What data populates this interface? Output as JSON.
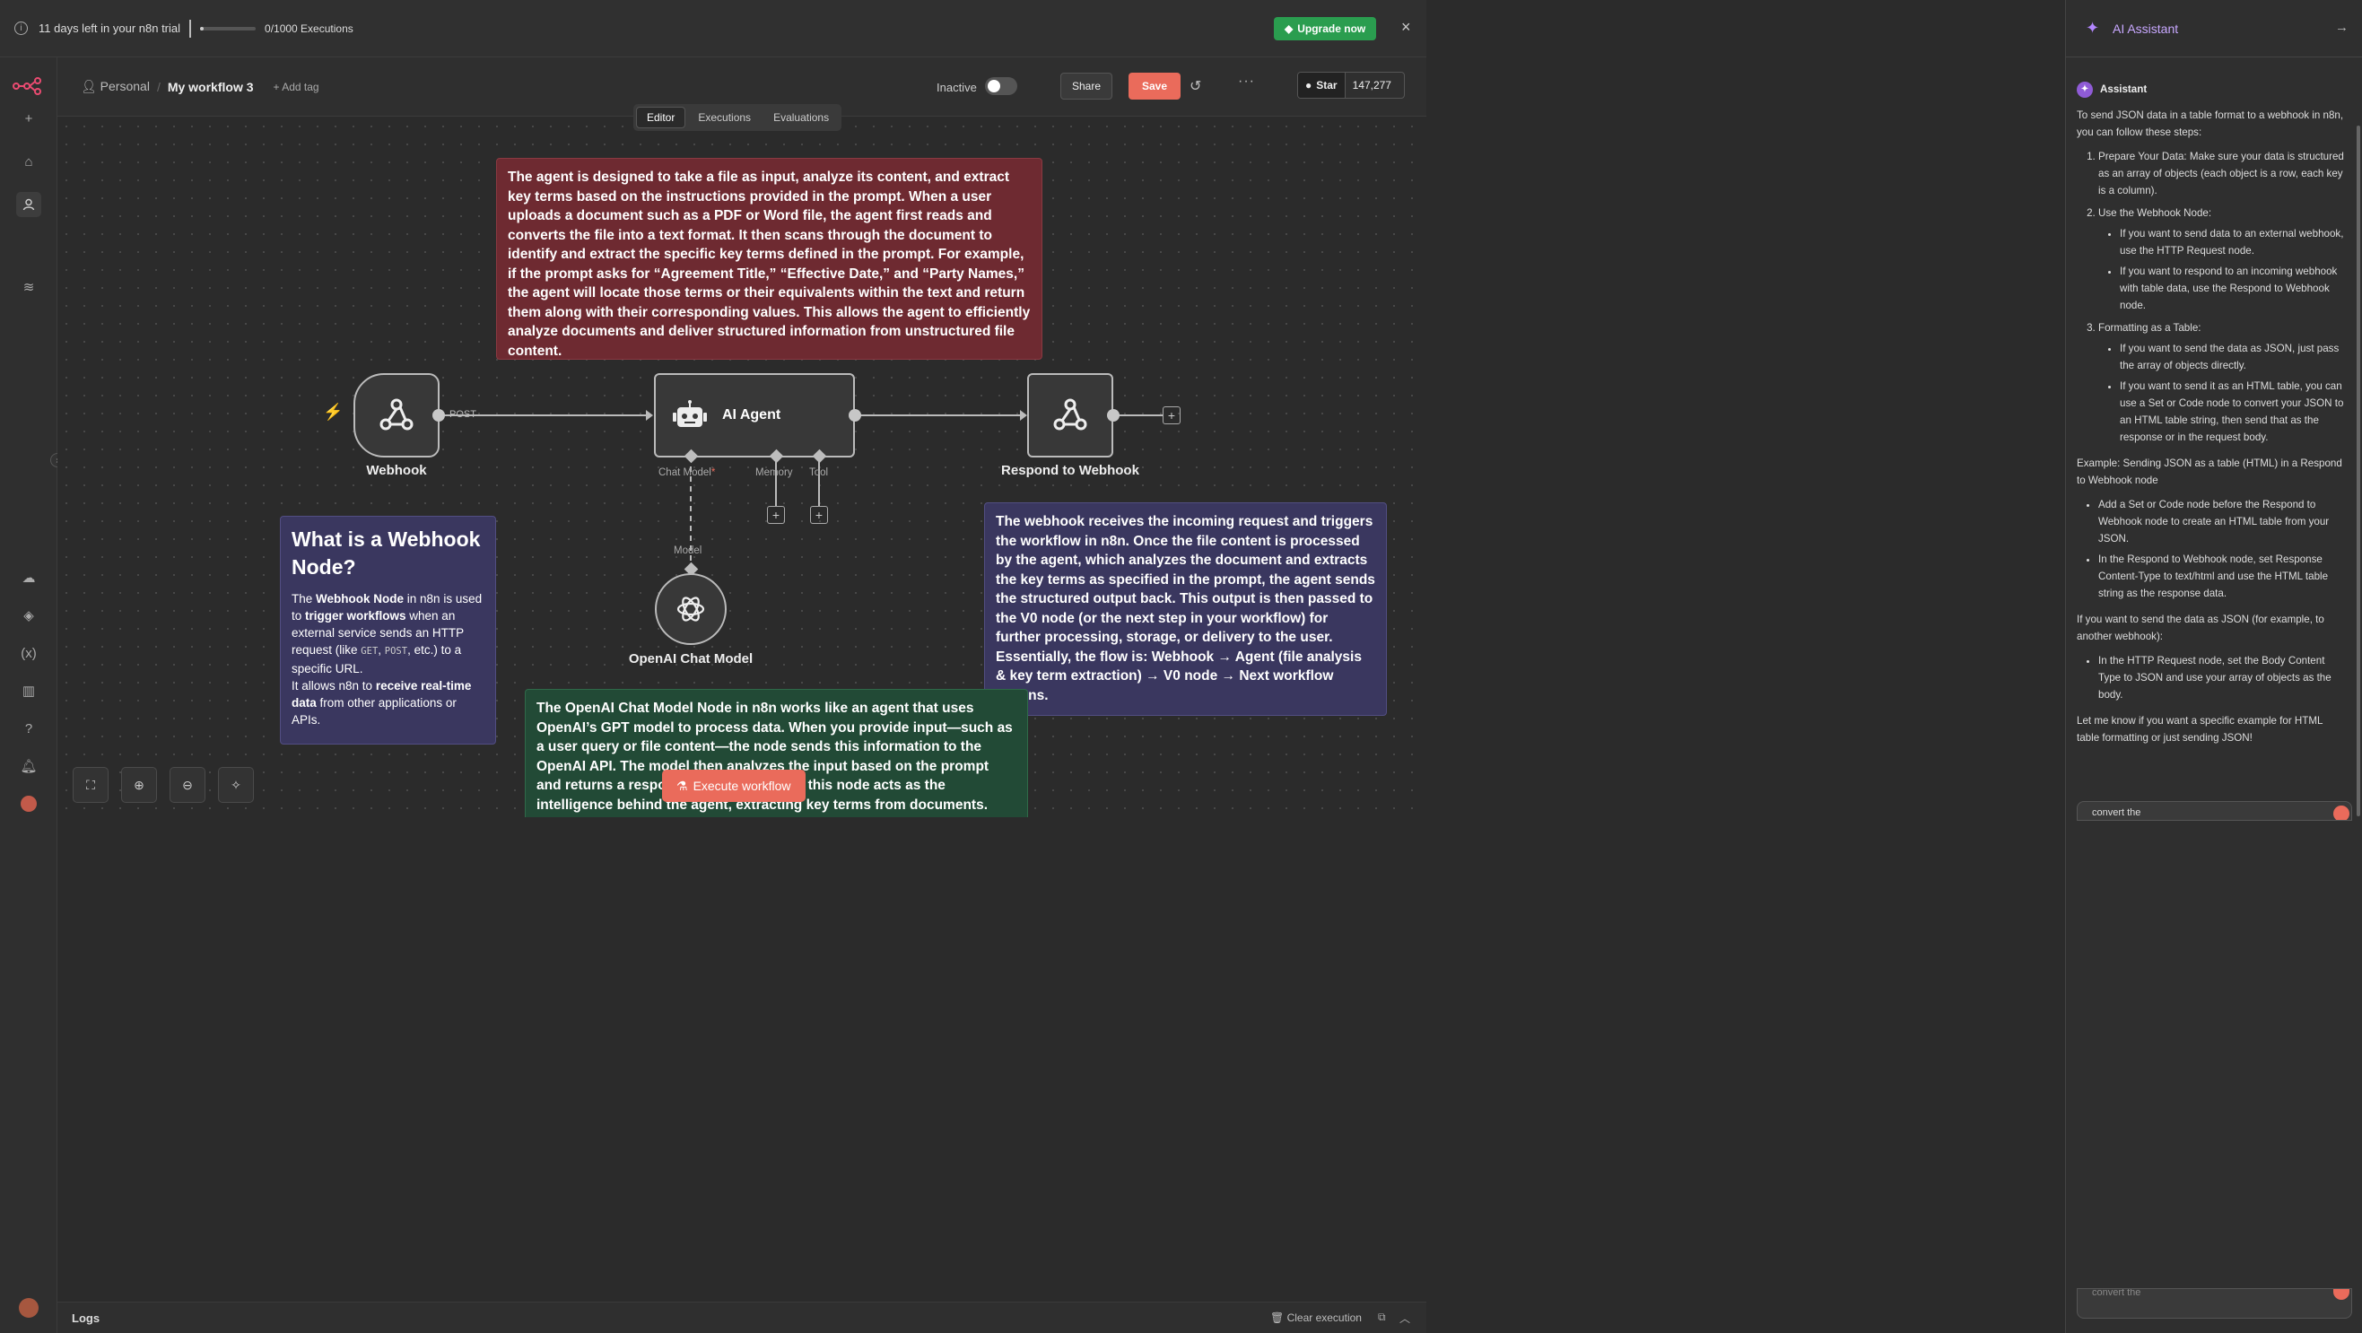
{
  "banner": {
    "trial_text": "11 days left in your n8n trial",
    "executions_text": "0/1000 Executions",
    "executions_used_fraction": 0,
    "upgrade_label": "Upgrade now"
  },
  "header": {
    "project": "Personal",
    "workflow_name": "My workflow 3",
    "add_tag": "+ Add tag",
    "status_label": "Inactive",
    "share_label": "Share",
    "save_label": "Save",
    "github_star_label": "Star",
    "github_star_count": "147,277"
  },
  "tabs": [
    "Editor",
    "Executions",
    "Evaluations"
  ],
  "nodes": {
    "webhook": {
      "label": "Webhook",
      "method": "POST"
    },
    "agent": {
      "label": "AI Agent",
      "chat_model": "Chat Model",
      "required_mark": "*",
      "memory": "Memory",
      "tool": "Tool"
    },
    "respond": {
      "label": "Respond to Webhook"
    },
    "openai": {
      "label": "OpenAI Chat Model",
      "connector": "Model"
    }
  },
  "notes": {
    "red": "The agent is designed to take a file as input, analyze its content, and extract key terms based on the instructions provided in the prompt. When a user uploads a document such as a PDF or Word file, the agent first reads and converts the file into a text format. It then scans through the document to identify and extract the specific key terms defined in the prompt. For example, if the prompt asks for “Agreement Title,” “Effective Date,” and “Party Names,” the agent will locate those terms or their equivalents within the text and return them along with their corresponding values. This allows the agent to efficiently analyze documents and deliver structured information from unstructured file content.",
    "webhook_title": "What is a Webhook Node?",
    "webhook_p1_a": "The ",
    "webhook_p1_b": "Webhook Node",
    "webhook_p1_c": " in n8n is used to ",
    "webhook_p1_d": "trigger workflows",
    "webhook_p1_e": " when an external service sends an HTTP request (like ",
    "webhook_p1_get": "GET",
    "webhook_p1_comma": ", ",
    "webhook_p1_post": "POST",
    "webhook_p1_f": ", etc.) to a specific URL.",
    "webhook_p2_a": "It allows n8n to ",
    "webhook_p2_b": "receive real-time data",
    "webhook_p2_c": " from other applications or APIs.",
    "purple_right": "The webhook receives the incoming request and triggers the workflow in n8n. Once the file content is processed by the agent, which analyzes the document and extracts the key terms as specified in the prompt, the agent sends the structured output back. This output is then passed to the V0 node (or the next step in your workflow) for further processing, storage, or delivery to the user. Essentially, the flow is: Webhook → Agent (file analysis & key term extraction) → V0 node → Next workflow actions.",
    "green": "The OpenAI Chat Model Node in n8n works like an agent that uses OpenAI’s GPT model to process data. When you provide input—such as a user query or file content—the node sends this information to the OpenAI API. The model then analyzes the input based on the prompt and returns a response. In our workflow, this node acts as the intelligence behind the agent, extracting key terms from documents."
  },
  "execute_label": "Execute workflow",
  "logs": {
    "title": "Logs",
    "clear_label": "Clear execution"
  },
  "assistant": {
    "panel_title": "AI Assistant",
    "sender": "Assistant",
    "intro": "To send JSON data in a table format to a webhook in n8n, you can follow these steps:",
    "steps": [
      {
        "text": "Prepare Your Data: Make sure your data is structured as an array of objects (each object is a row, each key is a column).",
        "bullets": []
      },
      {
        "text": "Use the Webhook Node:",
        "bullets": [
          "If you want to send data to an external webhook, use the HTTP Request node.",
          "If you want to respond to an incoming webhook with table data, use the Respond to Webhook node."
        ]
      },
      {
        "text": "Formatting as a Table:",
        "bullets": [
          "If you want to send the data as JSON, just pass the array of objects directly.",
          "If you want to send it as an HTML table, you can use a Set or Code node to convert your JSON to an HTML table string, then send that as the response or in the request body."
        ]
      }
    ],
    "example_heading": "Example: Sending JSON as a table (HTML) in a Respond to Webhook node",
    "example_bullets": [
      "Add a Set or Code node before the Respond to Webhook node to create an HTML table from your JSON.",
      "In the Respond to Webhook node, set Response Content-Type to text/html and use the HTML table string as the response data."
    ],
    "json_heading": "If you want to send the data as JSON (for example, to another webhook):",
    "json_bullets": [
      "In the HTTP Request node, set the Body Content Type to JSON and use your array of objects as the body."
    ],
    "closing": "Let me know if you want a specific example for HTML table formatting or just sending JSON!",
    "input_value": "convert the",
    "input_value_bottom": "convert the"
  },
  "colors": {
    "accent": "#ea6b5b",
    "upgrade": "#2a9d4f",
    "assistant_purple": "#c8a8ff"
  }
}
